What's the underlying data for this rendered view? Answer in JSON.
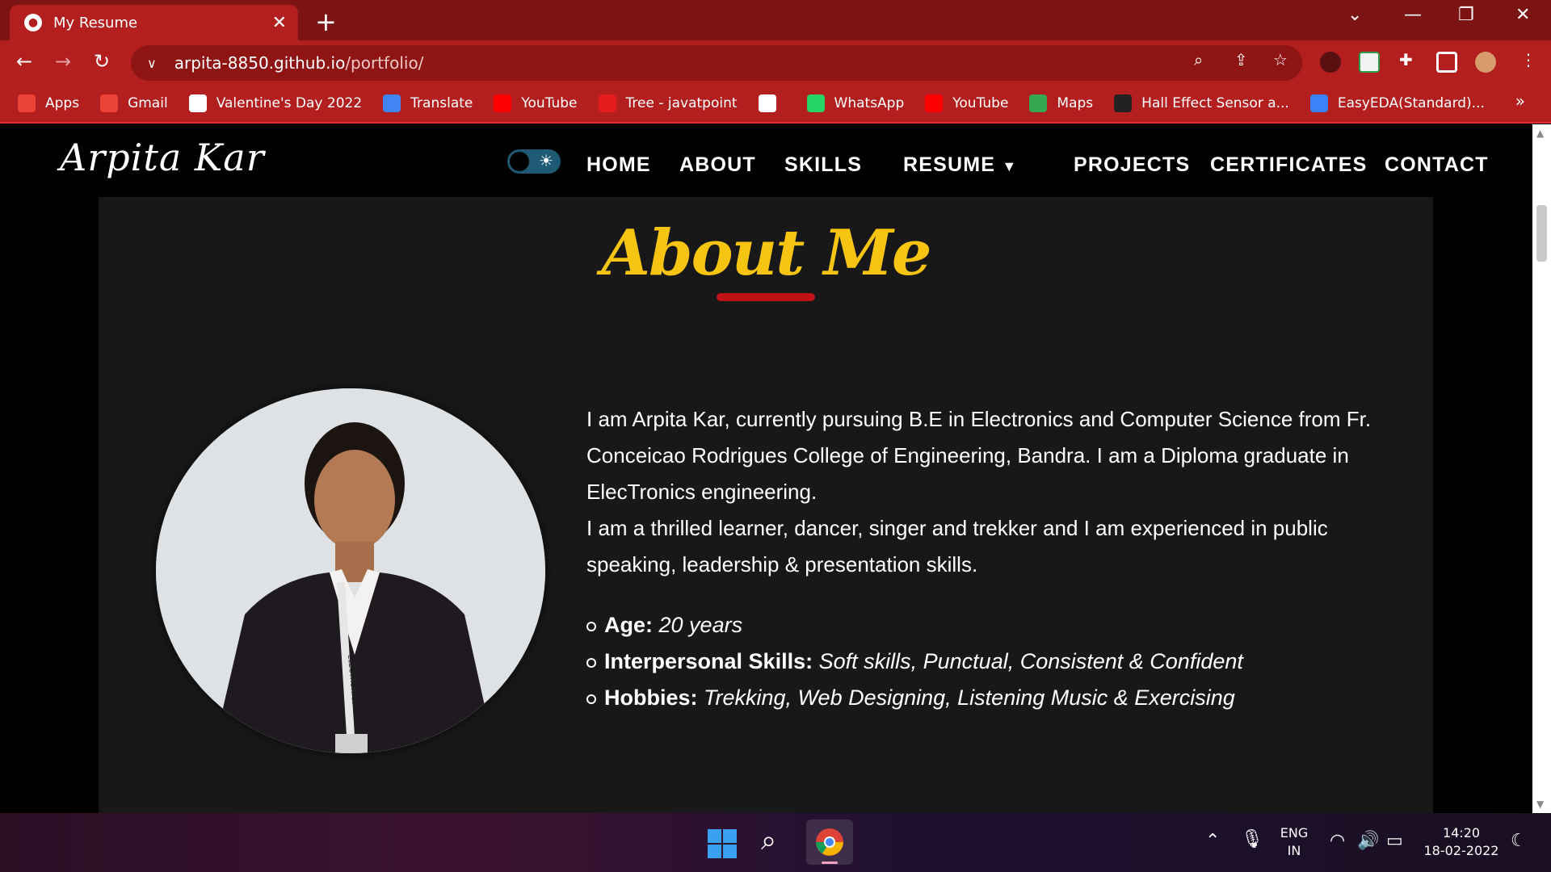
{
  "browser": {
    "tab_title": "My Resume",
    "url_host": "arpita-8850.github.io",
    "url_path": "/portfolio/",
    "bookmarks": [
      {
        "label": "Apps",
        "icon": "apps-grid-icon",
        "color": "#ea4335"
      },
      {
        "label": "Gmail",
        "icon": "gmail-icon",
        "color": "#ea4335"
      },
      {
        "label": "Valentine's Day 2022",
        "icon": "globe-icon",
        "color": "#ffffff"
      },
      {
        "label": "Translate",
        "icon": "translate-icon",
        "color": "#4285f4"
      },
      {
        "label": "YouTube",
        "icon": "youtube-icon",
        "color": "#ff0000"
      },
      {
        "label": "Tree - javatpoint",
        "icon": "javatpoint-icon",
        "color": "#e31b1b"
      },
      {
        "label": "",
        "icon": "globe-icon",
        "color": "#ffffff"
      },
      {
        "label": "WhatsApp",
        "icon": "whatsapp-icon",
        "color": "#25d366"
      },
      {
        "label": "YouTube",
        "icon": "youtube-icon",
        "color": "#ff0000"
      },
      {
        "label": "Maps",
        "icon": "maps-pin-icon",
        "color": "#34a853"
      },
      {
        "label": "Hall Effect Sensor a...",
        "icon": "site-icon",
        "color": "#222222"
      },
      {
        "label": "EasyEDA(Standard)...",
        "icon": "easyeda-icon",
        "color": "#3b82f6"
      }
    ],
    "bookmarks_more": "»"
  },
  "site": {
    "logo": "Arpita Kar",
    "nav": [
      "HOME",
      "ABOUT",
      "SKILLS",
      "RESUME",
      "PROJECTS",
      "CERTIFICATES",
      "CONTACT"
    ],
    "accent_color": "#f7c511",
    "underline_color": "#c01313"
  },
  "about": {
    "title": "About Me",
    "bio_1": "I am Arpita Kar, currently pursuing B.E in Electronics and Computer Science from Fr. Conceicao Rodrigues College of Engineering, Bandra. I am a Diploma graduate in ElecTronics engineering.",
    "bio_2": "I am a thrilled learner, dancer, singer and trekker and I am experienced in public speaking, leadership & presentation skills.",
    "facts": [
      {
        "label": "Age:",
        "value": "20 years"
      },
      {
        "label": "Interpersonal Skills:",
        "value": "Soft skills, Punctual, Consistent & Confident"
      },
      {
        "label": "Hobbies:",
        "value": "Trekking, Web Designing, Listening Music & Exercising"
      }
    ],
    "photo_badge": "ELECTRONICS"
  },
  "taskbar": {
    "lang_1": "ENG",
    "lang_2": "IN",
    "time": "14:20",
    "date": "18-02-2022"
  }
}
